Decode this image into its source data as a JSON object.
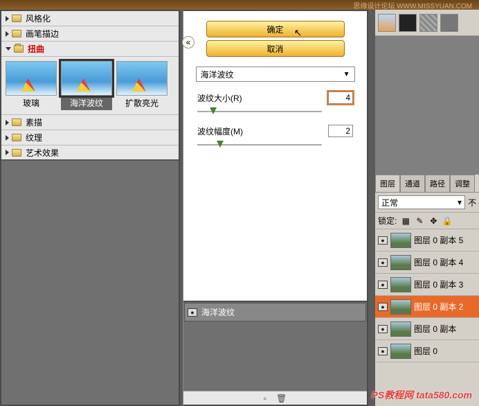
{
  "watermark_top": "思缘设计论坛 WWW.MISSYUAN.COM",
  "watermark_bottom": "PS教程网 tata580.com",
  "categories": {
    "stylize": "风格化",
    "brush": "画笔描边",
    "distort": "扭曲",
    "sketch": "素描",
    "texture": "纹理",
    "artistic": "艺术效果"
  },
  "thumbs": {
    "glass": "玻璃",
    "ocean": "海洋波纹",
    "diffuse": "扩散亮光"
  },
  "buttons": {
    "ok": "确定",
    "cancel": "取消"
  },
  "filter_select": "海洋波纹",
  "params": {
    "ripple_size_label": "波纹大小(R)",
    "ripple_size_val": "4",
    "ripple_mag_label": "波纹幅度(M)",
    "ripple_mag_val": "2"
  },
  "applied_filter": "海洋波纹",
  "panel_tabs": {
    "layers": "图层",
    "channels": "通道",
    "paths": "路径",
    "adjust": "调整"
  },
  "blend_mode": "正常",
  "opacity_label": "不",
  "lock_label": "锁定:",
  "layers": [
    "图层 0 副本 5",
    "图层 0 副本 4",
    "图层 0 副本 3",
    "图层 0 副本 2",
    "图层 0 副本",
    "图层 0"
  ]
}
